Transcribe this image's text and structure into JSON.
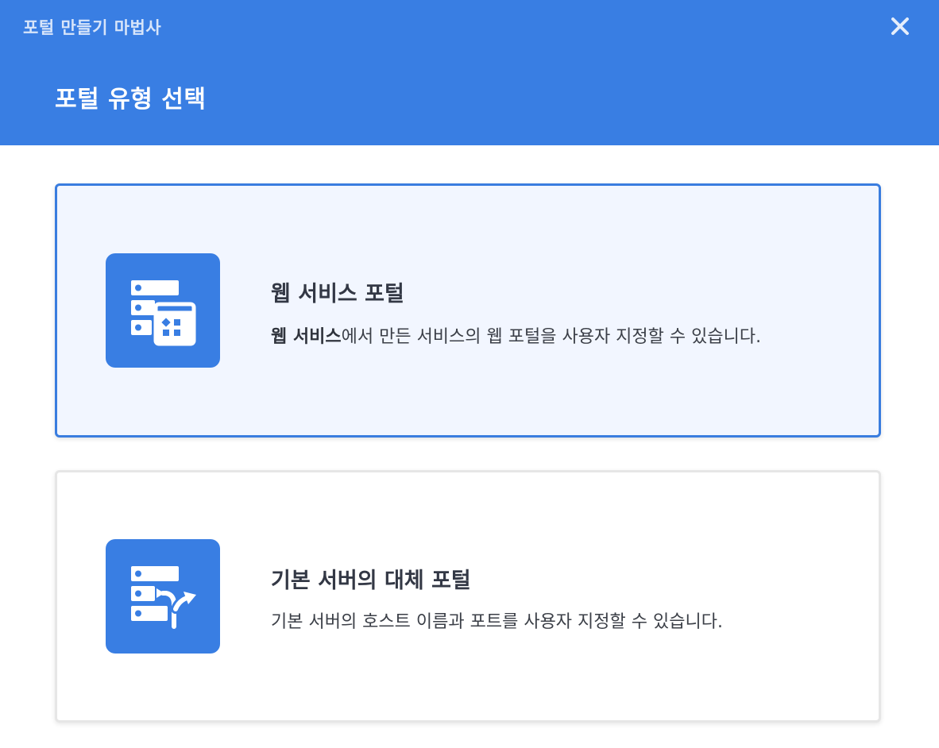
{
  "dialog": {
    "wizard_title": "포털 만들기 마법사",
    "step_title": "포털 유형 선택",
    "close_icon": "close-icon"
  },
  "options": [
    {
      "title": "웹 서비스 포털",
      "desc_bold": "웹 서비스",
      "desc_rest": "에서 만든 서비스의 웹 포털을 사용자 지정할 수 있습니다.",
      "icon": "web-service-portal-icon",
      "selected": true
    },
    {
      "title": "기본 서버의 대체 포털",
      "desc_bold": "",
      "desc_rest": "기본 서버의 호스트 이름과 포트를 사용자 지정할 수 있습니다.",
      "icon": "server-alternate-portal-icon",
      "selected": false
    }
  ],
  "colors": {
    "header_bg": "#397ee3",
    "accent": "#3a7ddf",
    "selected_card_bg": "#f2f6ff"
  }
}
